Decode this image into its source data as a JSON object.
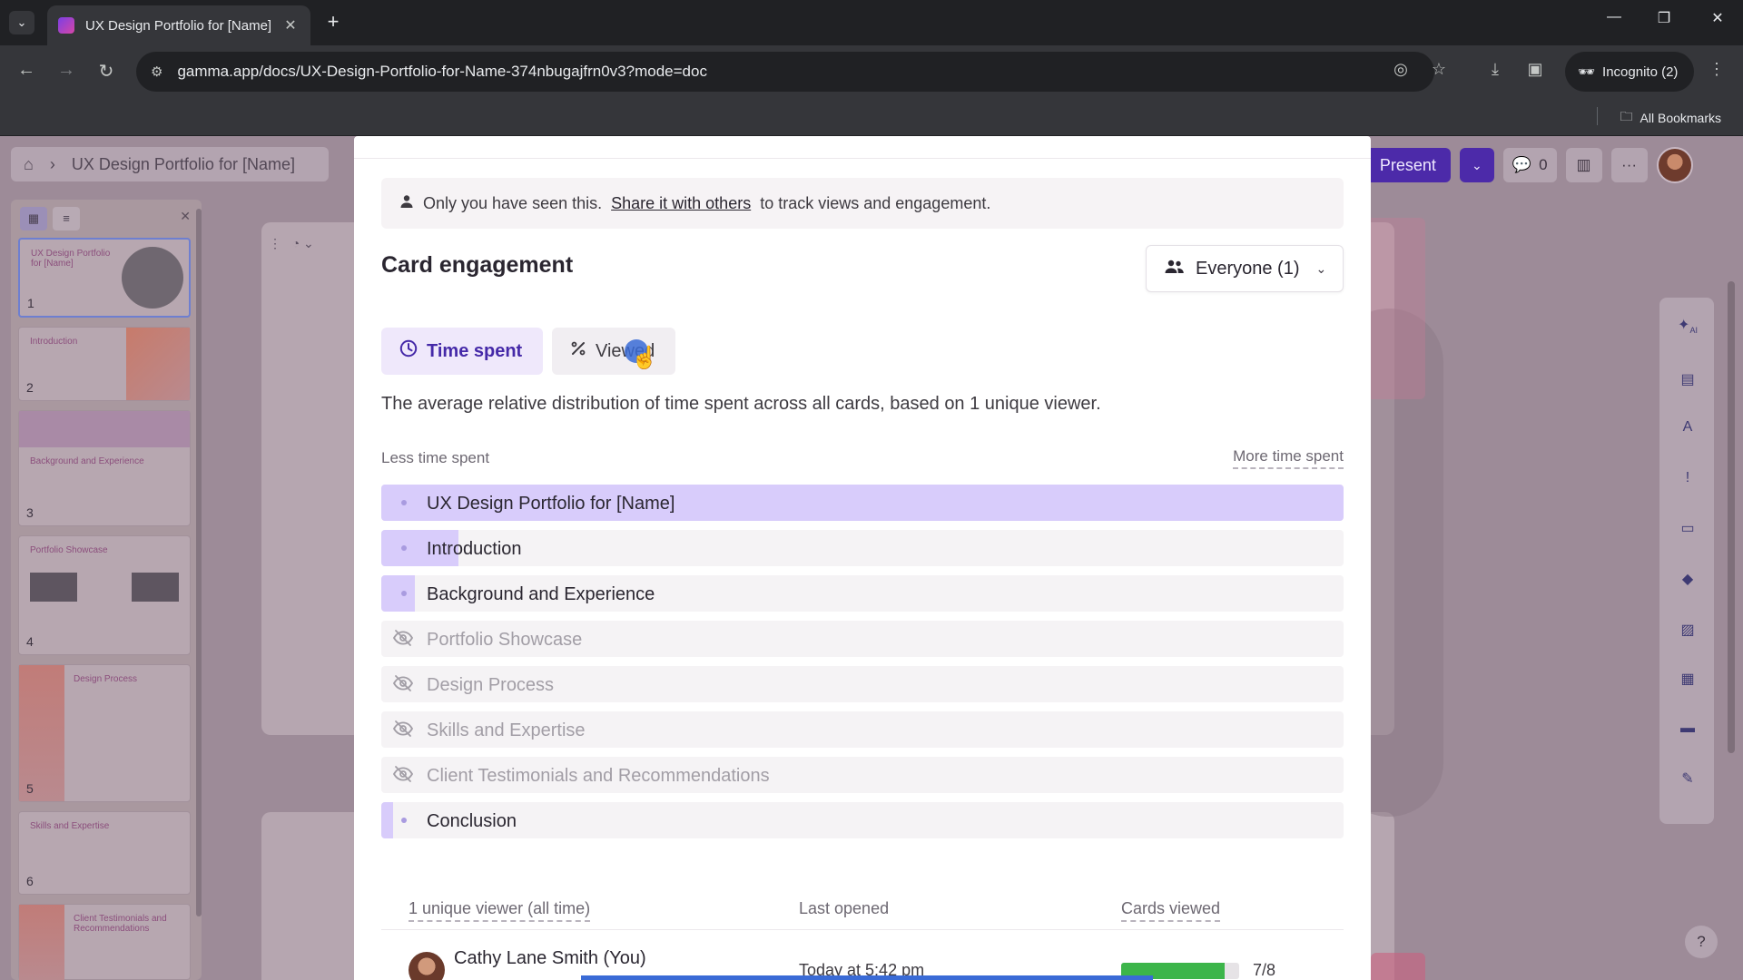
{
  "browser": {
    "tab_title": "UX Design Portfolio for [Name]",
    "url": "gamma.app/docs/UX-Design-Portfolio-for-Name-374nbugajfrn0v3?mode=doc",
    "incognito_label": "Incognito (2)",
    "bookmarks_label": "All Bookmarks"
  },
  "app": {
    "breadcrumb_title": "UX Design Portfolio for [Name]",
    "present_label": "Present",
    "comments_count": "0",
    "thumbnails": [
      {
        "num": "1",
        "title": "UX Design Portfolio for [Name]"
      },
      {
        "num": "2",
        "title": "Introduction"
      },
      {
        "num": "3",
        "title": "Background and Experience"
      },
      {
        "num": "4",
        "title": "Portfolio Showcase"
      },
      {
        "num": "5",
        "title": "Design Process"
      },
      {
        "num": "6",
        "title": "Skills and Expertise"
      },
      {
        "num": "",
        "title": "Client Testimonials and Recommendations"
      }
    ],
    "ai_badge": "AI",
    "help_label": "?"
  },
  "modal": {
    "notice_prefix": "Only you have seen this.",
    "notice_link": "Share it with others",
    "notice_suffix": "to track views and engagement.",
    "title": "Card engagement",
    "audience_dropdown": "Everyone (1)",
    "tab_time_spent": "Time spent",
    "tab_viewed": "Viewed",
    "description": "The average relative distribution of time spent across all cards, based on 1 unique viewer.",
    "legend_less": "Less time spent",
    "legend_more": "More time spent",
    "cards": [
      {
        "label": "UX Design Portfolio for [Name]",
        "viewed": true,
        "share": 1.0
      },
      {
        "label": "Introduction",
        "viewed": true,
        "share": 0.08
      },
      {
        "label": "Background and Experience",
        "viewed": true,
        "share": 0.035
      },
      {
        "label": "Portfolio Showcase",
        "viewed": false,
        "share": 0
      },
      {
        "label": "Design Process",
        "viewed": false,
        "share": 0
      },
      {
        "label": "Skills and Expertise",
        "viewed": false,
        "share": 0
      },
      {
        "label": "Client Testimonials and Recommendations",
        "viewed": false,
        "share": 0
      },
      {
        "label": "Conclusion",
        "viewed": true,
        "share": 0.012
      }
    ],
    "viewers_header": {
      "unique": "1 unique viewer (all time)",
      "last_opened": "Last opened",
      "cards_viewed": "Cards viewed"
    },
    "viewer": {
      "name": "Cathy Lane Smith (You)",
      "last_opened": "Today at 5:42 pm",
      "cards_viewed": "7/8",
      "progress": 0.875
    }
  },
  "colors": {
    "accent": "#4529a8",
    "bar_fill": "#d8ccfb",
    "progress_green": "#3cb54a"
  }
}
